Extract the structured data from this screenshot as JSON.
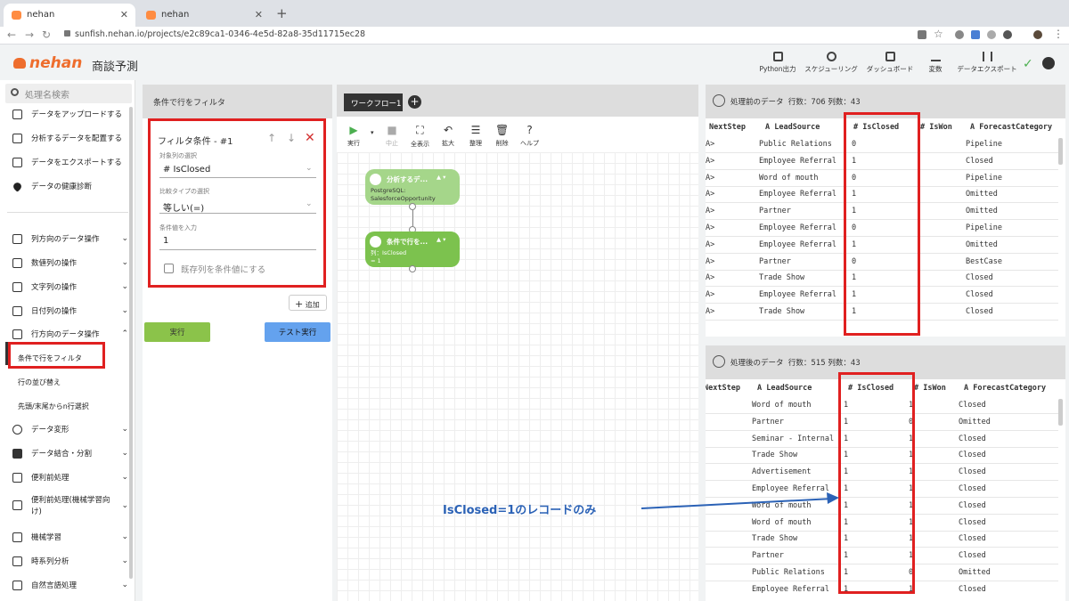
{
  "browser": {
    "tabs": [
      {
        "label": "nehan"
      },
      {
        "label": "nehan"
      }
    ],
    "url": "sunfish.nehan.io/projects/e2c89ca1-0346-4e5d-82a8-35d11715ec28"
  },
  "header": {
    "logo": "nehan",
    "project_name": "商談予測",
    "buttons": [
      {
        "label": "Python出力",
        "icon": "document-icon"
      },
      {
        "label": "スケジューリング",
        "icon": "schedule-icon"
      },
      {
        "label": "ダッシュボード",
        "icon": "dashboard-icon"
      },
      {
        "label": "変数",
        "icon": "variable-icon"
      },
      {
        "label": "データエクスポート",
        "icon": "export-icon"
      }
    ]
  },
  "sidebar": {
    "search_placeholder": "処理名検索",
    "top_items": [
      {
        "label": "データをアップロードする",
        "icon": "upload-icon"
      },
      {
        "label": "分析するデータを配置する",
        "icon": "place-data-icon"
      },
      {
        "label": "データをエクスポートする",
        "icon": "export-icon"
      },
      {
        "label": "データの健康診断",
        "icon": "heart-icon"
      }
    ],
    "categories": [
      {
        "label": "列方向のデータ操作",
        "icon": "columns-icon"
      },
      {
        "label": "数値列の操作",
        "icon": "columns-icon"
      },
      {
        "label": "文字列の操作",
        "icon": "columns-icon"
      },
      {
        "label": "日付列の操作",
        "icon": "columns-icon"
      },
      {
        "label": "行方向のデータ操作",
        "icon": "rows-icon",
        "expanded": true
      }
    ],
    "sub_items": [
      {
        "label": "条件で行をフィルタ",
        "selected": true
      },
      {
        "label": "行の並び替え"
      },
      {
        "label": "先頭/末尾からn行選択"
      }
    ],
    "more_categories": [
      {
        "label": "データ変形",
        "icon": "transform-icon"
      },
      {
        "label": "データ結合・分割",
        "icon": "puzzle-icon"
      },
      {
        "label": "便利前処理",
        "icon": "preprocess-icon"
      },
      {
        "label": "便利前処理(機械学習向",
        "label2": "け)",
        "icon": "preprocess-icon"
      },
      {
        "label": "機械学習",
        "icon": "ml-icon"
      },
      {
        "label": "時系列分析",
        "icon": "timeseries-icon"
      },
      {
        "label": "自然言語処理",
        "icon": "nlp-icon"
      }
    ]
  },
  "filter_panel": {
    "title": "条件で行をフィルタ",
    "condition_title": "フィルタ条件 - #1",
    "column_label": "対象列の選択",
    "column_value": "# IsClosed",
    "compare_label": "比較タイプの選択",
    "compare_value": "等しい(=)",
    "value_label": "条件値を入力",
    "value": "1",
    "checkbox_label": "既存列を条件値にする",
    "add_label": "追加",
    "run_label": "実行",
    "test_label": "テスト実行"
  },
  "workflow": {
    "tab_label": "ワークフロー1",
    "tools": [
      "実行",
      "中止",
      "全表示",
      "拡大",
      "整理",
      "削除",
      "ヘルプ"
    ],
    "nodes": [
      {
        "title": "分析するデ...",
        "desc1": "PostgreSQL:",
        "desc2": "SalesforceOpportunity"
      },
      {
        "title": "条件で行を...",
        "desc1": "列：IsClosed",
        "desc2": "= 1"
      }
    ]
  },
  "before_table": {
    "title": "処理前のデータ",
    "rows_label": "行数：706",
    "cols_label": "列数：43",
    "columns": [
      "NextStep",
      "A LeadSource",
      "# IsClosed",
      "# IsWon",
      "A ForecastCategory"
    ],
    "rows": [
      [
        "A>",
        "Public Relations",
        "0",
        "",
        "Pipeline"
      ],
      [
        "A>",
        "Employee Referral",
        "1",
        "",
        "Closed"
      ],
      [
        "A>",
        "Word of mouth",
        "0",
        "",
        "Pipeline"
      ],
      [
        "A>",
        "Employee Referral",
        "1",
        "",
        "Omitted"
      ],
      [
        "A>",
        "Partner",
        "1",
        "",
        "Omitted"
      ],
      [
        "A>",
        "Employee Referral",
        "0",
        "",
        "Pipeline"
      ],
      [
        "A>",
        "Employee Referral",
        "1",
        "",
        "Omitted"
      ],
      [
        "A>",
        "Partner",
        "0",
        "",
        "BestCase"
      ],
      [
        "A>",
        "Trade Show",
        "1",
        "",
        "Closed"
      ],
      [
        "A>",
        "Employee Referral",
        "1",
        "",
        "Closed"
      ],
      [
        "A>",
        "Trade Show",
        "1",
        "",
        "Closed"
      ]
    ]
  },
  "after_table": {
    "title": "処理後のデータ",
    "rows_label": "行数：515",
    "cols_label": "列数：43",
    "columns": [
      "NextStep",
      "A LeadSource",
      "# IsClosed",
      "# IsWon",
      "A ForecastCategory"
    ],
    "rows": [
      [
        "",
        "Word of mouth",
        "1",
        "1",
        "Closed"
      ],
      [
        "",
        "Partner",
        "1",
        "0",
        "Omitted"
      ],
      [
        "",
        "Seminar - Internal",
        "1",
        "1",
        "Closed"
      ],
      [
        "",
        "Trade Show",
        "1",
        "1",
        "Closed"
      ],
      [
        "",
        "Advertisement",
        "1",
        "1",
        "Closed"
      ],
      [
        "",
        "Employee Referral",
        "1",
        "1",
        "Closed"
      ],
      [
        "",
        "Word of mouth",
        "1",
        "1",
        "Closed"
      ],
      [
        "",
        "Word of mouth",
        "1",
        "1",
        "Closed"
      ],
      [
        "",
        "Trade Show",
        "1",
        "1",
        "Closed"
      ],
      [
        "",
        "Partner",
        "1",
        "1",
        "Closed"
      ],
      [
        "",
        "Public Relations",
        "1",
        "0",
        "Omitted"
      ],
      [
        "",
        "Employee Referral",
        "1",
        "1",
        "Closed"
      ]
    ]
  },
  "annotation": {
    "text": "IsClosed=1のレコードのみ",
    "color": "#2b62b6"
  },
  "colors": {
    "highlight": "#e02020",
    "brand": "#ee6d2d",
    "run": "#8bc34a",
    "test": "#64a2ee",
    "node_source": "#a5d68a",
    "node_filter": "#7cc24e"
  }
}
